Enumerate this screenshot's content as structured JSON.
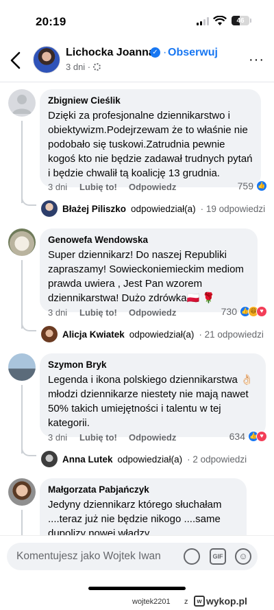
{
  "status_bar": {
    "time": "20:19",
    "battery": "46"
  },
  "header": {
    "name": "Lichocka Joanna",
    "separator": "·",
    "follow_label": "Obserwuj",
    "meta": "3 dni ·",
    "more_label": "···"
  },
  "comments": [
    {
      "author": "Zbigniew Cieślik",
      "text": "Dzięki za profesjonalne dziennikarstwo i obiektywizm.Podejrzewam że to właśnie nie podobało się tuskowi.Zatrudnia pewnie kogoś kto nie będzie zadawał trudnych pytań i będzie chwalił tą koalicję 13 grudnia.",
      "time": "3 dni",
      "like_label": "Lubię to!",
      "reply_label": "Odpowiedz",
      "reaction_count": "759",
      "reply_name": "Błażej Piliszko",
      "reply_text": "odpowiedział(a)",
      "reply_count": "· 19 odpowiedzi"
    },
    {
      "author": "Genowefa Wendowska",
      "text": "Super dziennikarz! Do naszej Republiki zapraszamy!  Sowieckoniemieckim mediom prawda uwiera , Jest Pan wzorem dziennikarstwa! Dużo zdrówka🇵🇱 🌹",
      "time": "3 dni",
      "like_label": "Lubię to!",
      "reply_label": "Odpowiedz",
      "reaction_count": "730",
      "reply_name": "Alicja Kwiatek",
      "reply_text": "odpowiedział(a)",
      "reply_count": "· 21 odpowiedzi"
    },
    {
      "author": "Szymon Bryk",
      "text": "Legenda i ikona polskiego dziennikarstwa 👌🏻 młodzi dziennikarze niestety nie mają nawet 50% takich umiejętności i talentu w tej kategorii.",
      "time": "3 dni",
      "like_label": "Lubię to!",
      "reply_label": "Odpowiedz",
      "reaction_count": "634",
      "reply_name": "Anna Lutek",
      "reply_text": "odpowiedział(a)",
      "reply_count": "· 2 odpowiedzi"
    },
    {
      "author": "Małgorzata Pabjańczyk",
      "text": "Jedyny dziennikarz którego słuchałam ....teraz już nie będzie nikogo ....same dupolizy nowej władzy ...."
    }
  ],
  "composer": {
    "placeholder": "Komentujesz jako Wojtek Iwan",
    "gif_label": "GIF"
  },
  "footer": {
    "user": "wojtek2201",
    "z": "z",
    "site": "wykop.pl"
  },
  "colors": {
    "accent": "#1877f2",
    "bubble": "#f0f2f5",
    "muted": "#65676b"
  },
  "icons": [
    "back-chevron-icon",
    "verified-badge-icon",
    "gear-icon",
    "more-icon",
    "like-reaction-icon",
    "heart-reaction-icon",
    "haha-reaction-icon",
    "avatar-sticker-icon",
    "gif-icon",
    "emoji-icon"
  ]
}
